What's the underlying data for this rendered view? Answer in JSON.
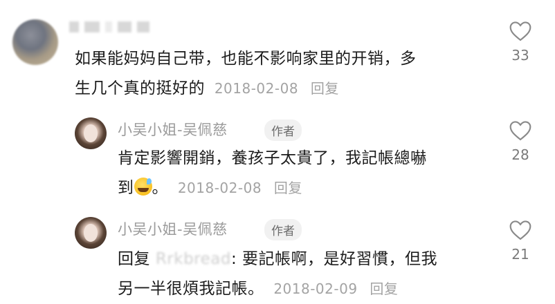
{
  "comments": [
    {
      "text_line1": "如果能妈妈自己带，也能不影响家里的开销，多",
      "text_line2": "生几个真的挺好的",
      "date": "2018-02-08",
      "reply_label": "回复",
      "likes": "33"
    }
  ],
  "replies": [
    {
      "author": "小吴小姐-吴佩慈",
      "badge": "作者",
      "text_line1": "肯定影響開銷，養孩子太貴了，我記帳總嚇",
      "text_line2_prefix": "到",
      "text_line2_suffix": "。",
      "date": "2018-02-08",
      "reply_label": "回复",
      "likes": "28"
    },
    {
      "author": "小吴小姐-吴佩慈",
      "badge": "作者",
      "reply_prefix": "回复",
      "mention": "Rrkbread",
      "text_line1_rest": ": 要記帳啊，是好習慣，但我",
      "text_line2": "另一半很煩我記帳。",
      "date": "2018-02-09",
      "reply_label": "回复",
      "likes": "21"
    }
  ]
}
